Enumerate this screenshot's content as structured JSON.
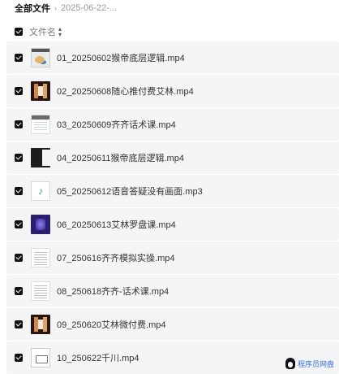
{
  "breadcrumb": {
    "root": "全部文件",
    "separator": "›",
    "current": "2025-06-22-..."
  },
  "header": {
    "column_label": "文件名",
    "sort_icon": "sort-icon"
  },
  "files": [
    {
      "name": "01_20250602猴帝底层逻辑.mp4",
      "thumb": "t-map"
    },
    {
      "name": "02_20250608随心推付费艾林.mp4",
      "thumb": "t-stage"
    },
    {
      "name": "03_20250609齐齐话术课.mp4",
      "thumb": "t-video-light"
    },
    {
      "name": "04_20250611猴帝底层逻辑.mp4",
      "thumb": "t-dark"
    },
    {
      "name": "05_20250612语音答疑没有画面.mp3",
      "thumb": "t-audio"
    },
    {
      "name": "06_20250613艾林罗盘课.mp4",
      "thumb": "t-purple"
    },
    {
      "name": "07_250616齐齐模拟实操.mp4",
      "thumb": "t-doc"
    },
    {
      "name": "08_250618齐齐-话术课.mp4",
      "thumb": "t-doc"
    },
    {
      "name": "09_250620艾林微付费.mp4",
      "thumb": "t-stage"
    },
    {
      "name": "10_250622千川.mp4",
      "thumb": "t-file"
    }
  ],
  "watermark": {
    "text": "程序员网盘"
  }
}
